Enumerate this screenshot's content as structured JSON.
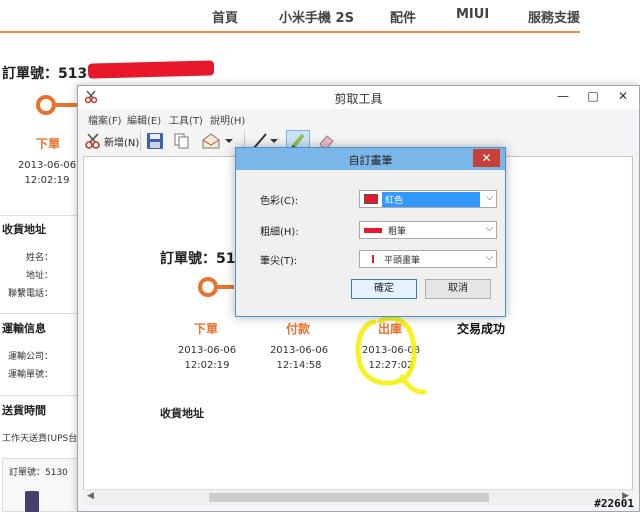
{
  "nav": {
    "items": [
      "首頁",
      "小米手機 2S",
      "配件",
      "MIUI",
      "服務支援"
    ]
  },
  "page": {
    "order_title": "訂單號：513",
    "step_label": "下單",
    "date": "2013-06-06",
    "time": "12:02:19",
    "sections": {
      "address": "收貨地址",
      "shipping": "運輸信息",
      "delivery_time": "送貨時間"
    },
    "address_fields": [
      "姓名：",
      "地址：",
      "聯繫電話："
    ],
    "shipping_fields": [
      "運輸公司：",
      "運輸單號："
    ],
    "delivery_text": "工作天送貨(UPS台",
    "bottom_order": "訂單號：5130"
  },
  "snip": {
    "title": "剪取工具",
    "min_label": "—",
    "max_label": "□",
    "close_label": "✕",
    "menu": [
      "檔案(F)",
      "編輯(E)",
      "工具(T)",
      "說明(H)"
    ],
    "new_label": "新增(N)",
    "canvas": {
      "order_title": "訂單號：51",
      "recv_title": "收貨地址",
      "steps": [
        {
          "label": "下單",
          "date": "2013-06-06",
          "time": "12:02:19",
          "color": "#e9732e"
        },
        {
          "label": "付款",
          "date": "2013-06-06",
          "time": "12:14:58",
          "color": "#e9732e"
        },
        {
          "label": "出庫",
          "date": "2013-06-08",
          "time": "12:27:02",
          "color": "#e9732e"
        },
        {
          "label": "交易成功",
          "color": "#111111"
        }
      ]
    }
  },
  "dialog": {
    "title": "自訂畫筆",
    "close_label": "✕",
    "color_label": "色彩(C):",
    "color_value": "紅色",
    "thickness_label": "粗細(H):",
    "thickness_value": "粗筆",
    "tip_label": "筆尖(T):",
    "tip_value": "平頭畫筆",
    "ok_label": "確定",
    "cancel_label": "取消"
  },
  "stamp": "#22601",
  "colors": {
    "accent": "#e9732e",
    "highlighter": "#f5f000",
    "pen_red": "#e8172c",
    "dialog_blue": "#7ab7e8"
  }
}
